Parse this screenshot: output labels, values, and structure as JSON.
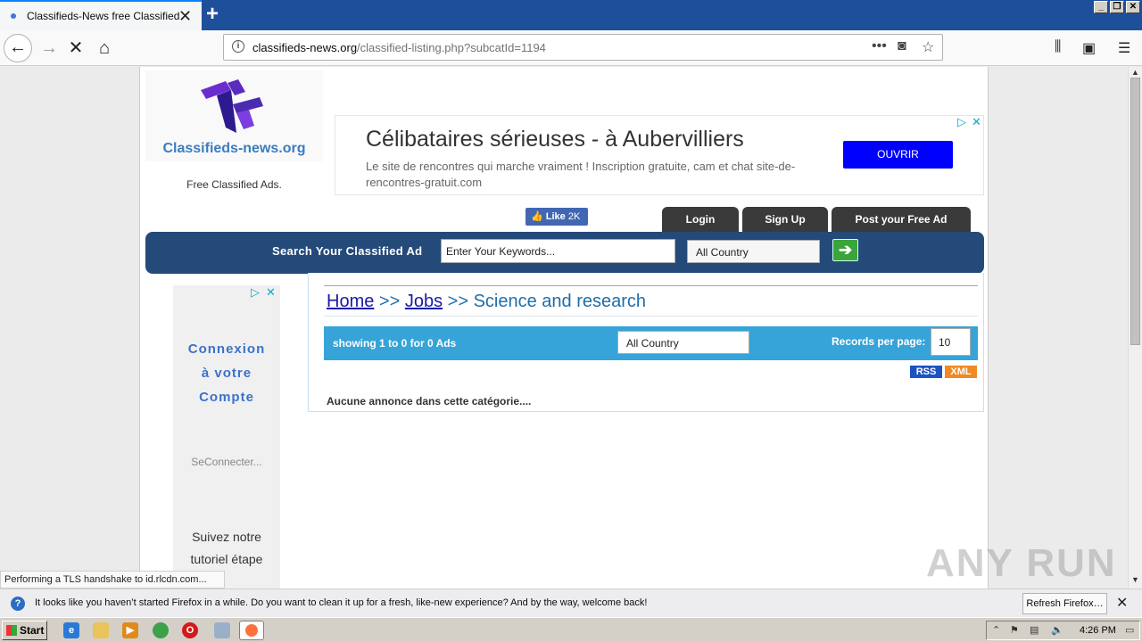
{
  "browser": {
    "tab_title": "Classifieds-News free Classified",
    "new_tab": "+",
    "url_domain": "classifieds-news.org",
    "url_path": "/classified-listing.php?subcatId=1194"
  },
  "site": {
    "logo_text": "Classifieds-news.org",
    "tagline": "Free Classified Ads.",
    "fb_like_label": "Like",
    "fb_like_count": "2K",
    "tabs": [
      "Login",
      "Sign Up",
      "Post your Free Ad"
    ],
    "search_label": "Search Your Classified Ad",
    "search_placeholder": "Enter Your Keywords...",
    "country_select": "All Country"
  },
  "ad_banner": {
    "headline": "Célibataires sérieuses - à Aubervilliers",
    "description": "Le site de rencontres qui marche vraiment ! Inscription gratuite, cam et chat site-de-rencontres-gratuit.com",
    "button": "OUVRIR"
  },
  "side_ad": {
    "title": "Connexion à votre Compte",
    "link": "SeConnecter...",
    "body": "Suivez notre tutoriel étape"
  },
  "breadcrumb": {
    "home": "Home",
    "sep1": ">>",
    "category": "Jobs",
    "sep2": ">>",
    "subcategory": "Science and research"
  },
  "listing": {
    "showing": "showing 1 to 0 for 0 Ads",
    "country": "All Country",
    "records_label": "Records per page:",
    "records_value": "10",
    "rss": "RSS",
    "xml": "XML",
    "empty_message": "Aucune annonce dans cette catégorie...."
  },
  "status_text": "Performing a TLS handshake to id.rlcdn.com...",
  "notification": {
    "message": "It looks like you haven’t started Firefox in a while. Do you want to clean it up for a fresh, like-new experience? And by the way, welcome back!",
    "button": "Refresh Firefox…"
  },
  "taskbar": {
    "start": "Start",
    "clock": "4:26 PM"
  },
  "watermark": "ANY RUN"
}
